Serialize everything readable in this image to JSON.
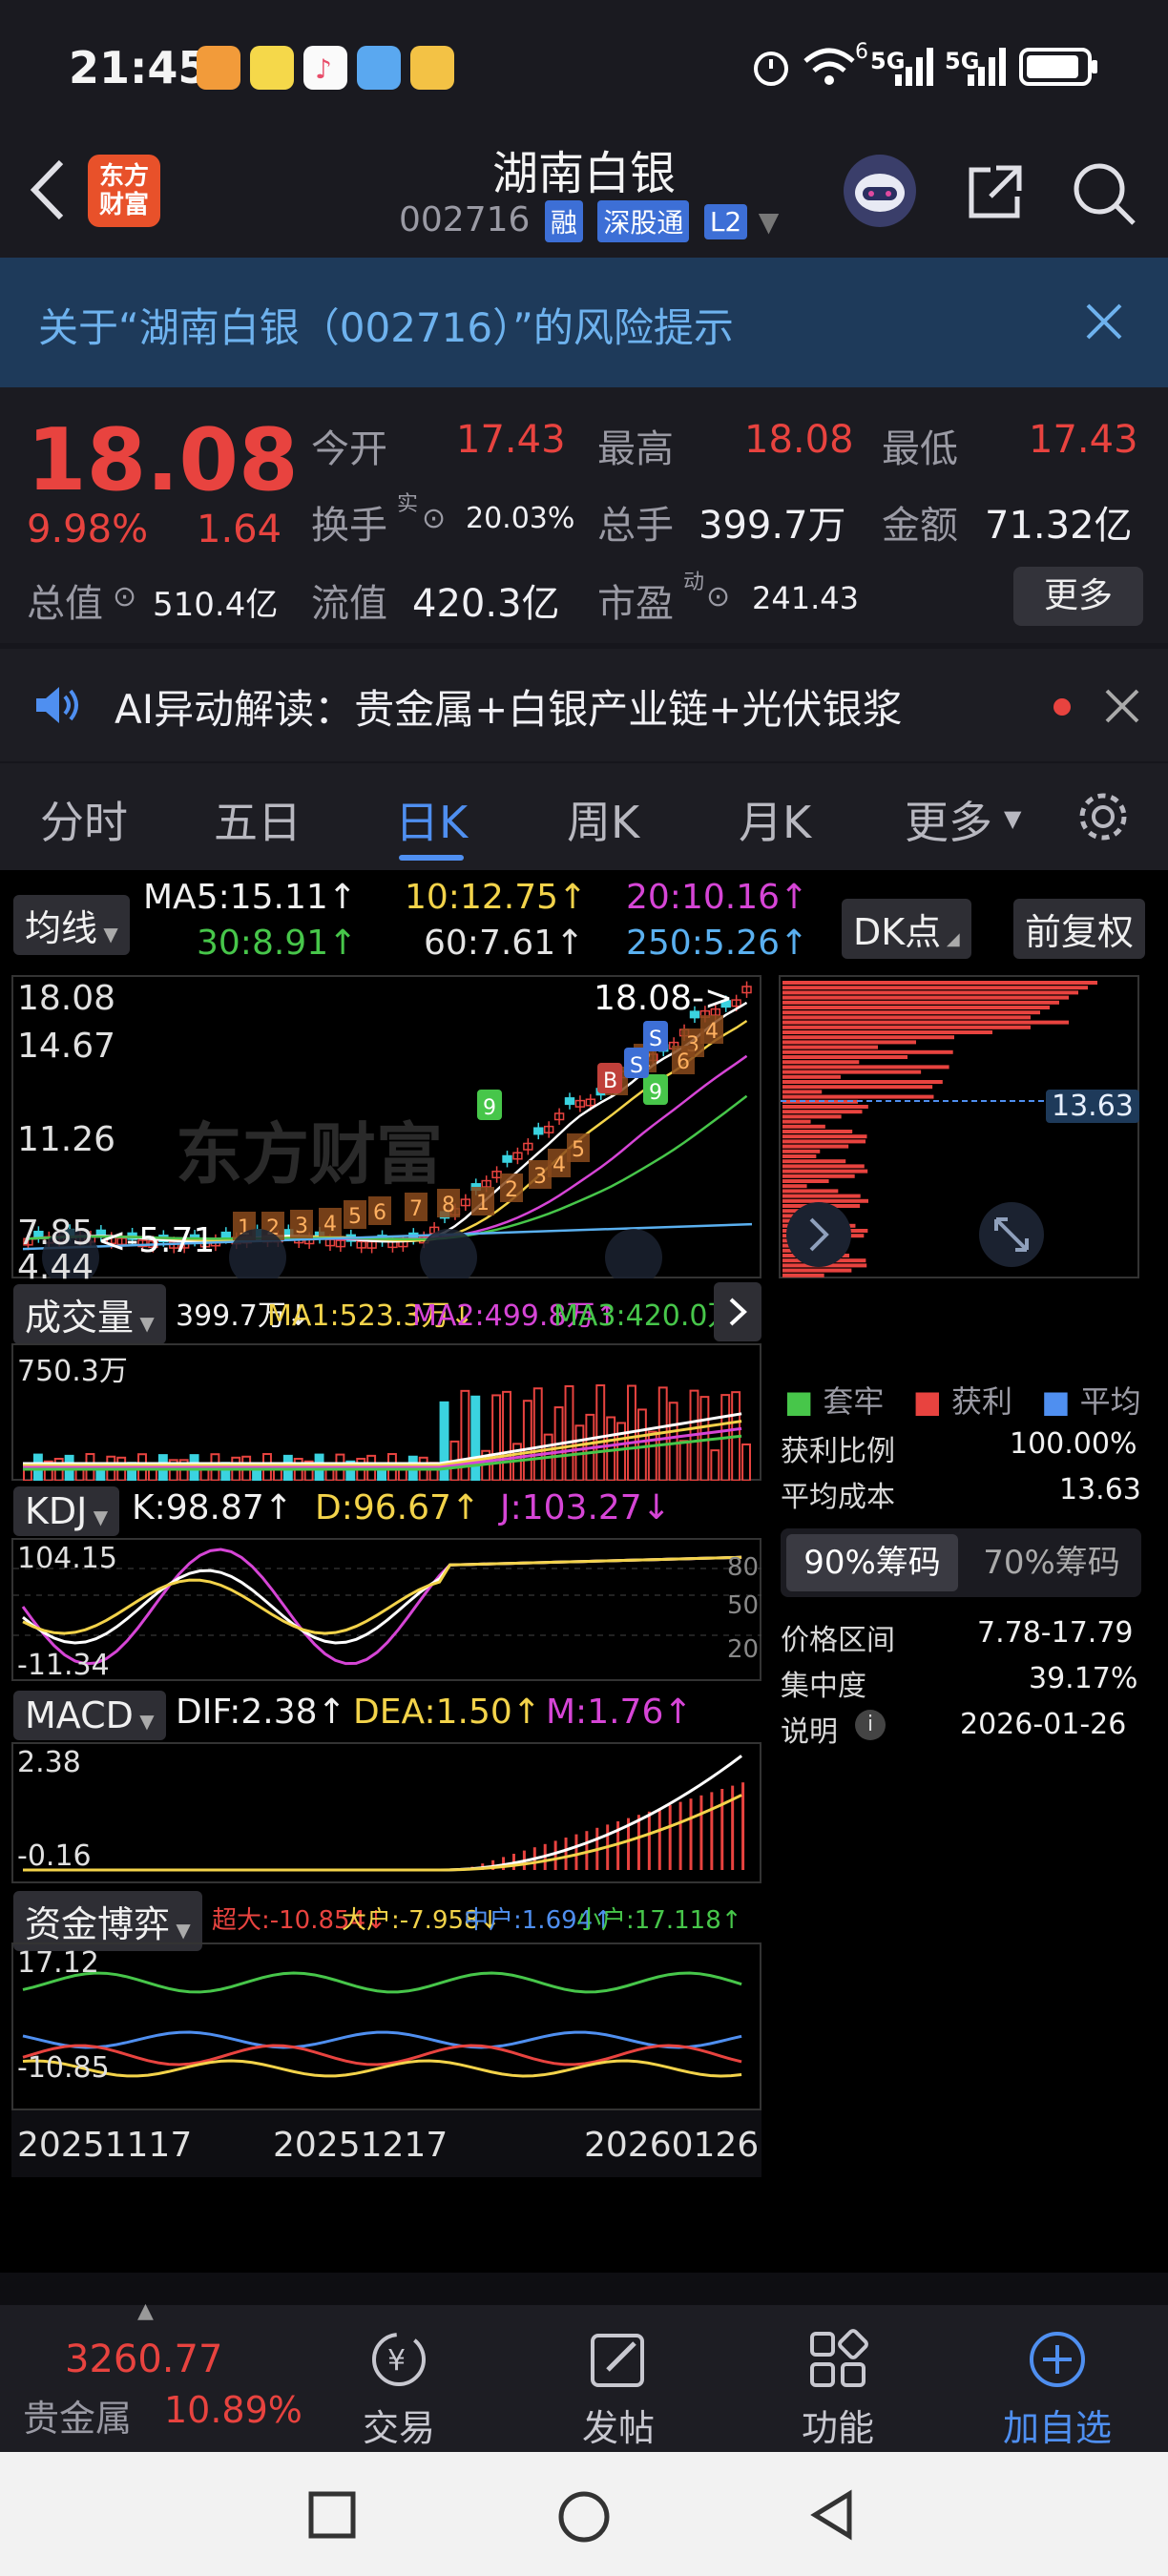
{
  "status": {
    "time": "21:45",
    "network": "5G",
    "network2": "5G",
    "wifi_sup": "6"
  },
  "header": {
    "logo": "东方\n财富",
    "title": "湖南白银",
    "code": "002716",
    "tags": [
      "融",
      "深股通",
      "L2"
    ]
  },
  "risk": {
    "text": "关于“湖南白银（002716）”的风险提示"
  },
  "quote": {
    "price": "18.08",
    "change_pct": "9.98%",
    "change": "1.64",
    "open_label": "今开",
    "open": "17.43",
    "high_label": "最高",
    "high": "18.08",
    "low_label": "最低",
    "low": "17.43",
    "turnover_label": "换手",
    "turnover_sup": "实",
    "turnover": "20.03%",
    "volume_label": "总手",
    "volume": "399.7万",
    "amount_label": "金额",
    "amount": "71.32亿",
    "mcap_label": "总值",
    "mcap": "510.4亿",
    "float_label": "流值",
    "float": "420.3亿",
    "pe_label": "市盈",
    "pe_sup": "动",
    "pe": "241.43",
    "more": "更多"
  },
  "ai": {
    "text": "AI异动解读：贵金属+白银产业链+光伏银浆"
  },
  "tabs": [
    "分时",
    "五日",
    "日K",
    "周K",
    "月K",
    "更多"
  ],
  "ma": {
    "selector": "均线",
    "ma5": "MA5:15.11↑",
    "ma10": "10:12.75↑",
    "ma20": "20:10.16↑",
    "ma30": "30:8.91↑",
    "ma60": "60:7.61↑",
    "ma250": "250:5.26↑",
    "dk": "DK点",
    "fq": "前复权"
  },
  "kline": {
    "y_labels": [
      "18.08",
      "14.67",
      "11.26",
      "7.85",
      "4.44"
    ],
    "last_price_note": "18.08->",
    "low_note": "<-5.71",
    "watermark": "东方财富",
    "markers": [
      "1",
      "2",
      "3",
      "4",
      "5",
      "6",
      "7",
      "8",
      "9",
      "1",
      "2",
      "3",
      "4",
      "5",
      "6",
      "7",
      "8",
      "9",
      "1",
      "2",
      "3",
      "4",
      "5",
      "6",
      "S",
      "S",
      "B"
    ],
    "chip_level": "13.63"
  },
  "volume": {
    "selector": "成交量",
    "v": "399.7万↓",
    "ma1": "MA1:523.3万↓",
    "ma2": "MA2:499.8万↑",
    "ma3": "MA3:420.0万↑",
    "y_label": "750.3万"
  },
  "kdj": {
    "selector": "KDJ",
    "k": "K:98.87↑",
    "d": "D:96.67↑",
    "j": "J:103.27↓",
    "y_top": "104.15",
    "y_bottom": "-11.34",
    "levels": [
      "80",
      "50",
      "20"
    ]
  },
  "macd": {
    "selector": "MACD",
    "dif": "DIF:2.38↑",
    "dea": "DEA:1.50↑",
    "m": "M:1.76↑",
    "y_top": "2.38",
    "y_bottom": "-0.16"
  },
  "fund": {
    "selector": "资金博弈",
    "big_super": "超大:-10.854↓",
    "big": "大户:-7.958↓",
    "mid": "中户:1.694↑",
    "small": "小户:17.118↑",
    "y_top": "17.12",
    "y_bottom": "-10.85"
  },
  "dates": [
    "20251117",
    "20251217",
    "20260126"
  ],
  "chips": {
    "legend": [
      "套牢",
      "获利",
      "平均"
    ],
    "profit_ratio_label": "获利比例",
    "profit_ratio": "100.00%",
    "avg_cost_label": "平均成本",
    "avg_cost": "13.63",
    "tab90": "90%筹码",
    "tab70": "70%筹码",
    "range_label": "价格区间",
    "range": "7.78-17.79",
    "concentration_label": "集中度",
    "concentration": "39.17%",
    "note_label": "说明",
    "date": "2026-01-26"
  },
  "bottom": {
    "index_value": "3260.77",
    "index_name": "贵金属",
    "index_pct": "10.89%",
    "items": [
      "交易",
      "发帖",
      "功能",
      "加自选"
    ]
  },
  "colors": {
    "up": "#e8433f",
    "accent": "#4f8ff0",
    "risk_bg": "#1e3a5a"
  }
}
